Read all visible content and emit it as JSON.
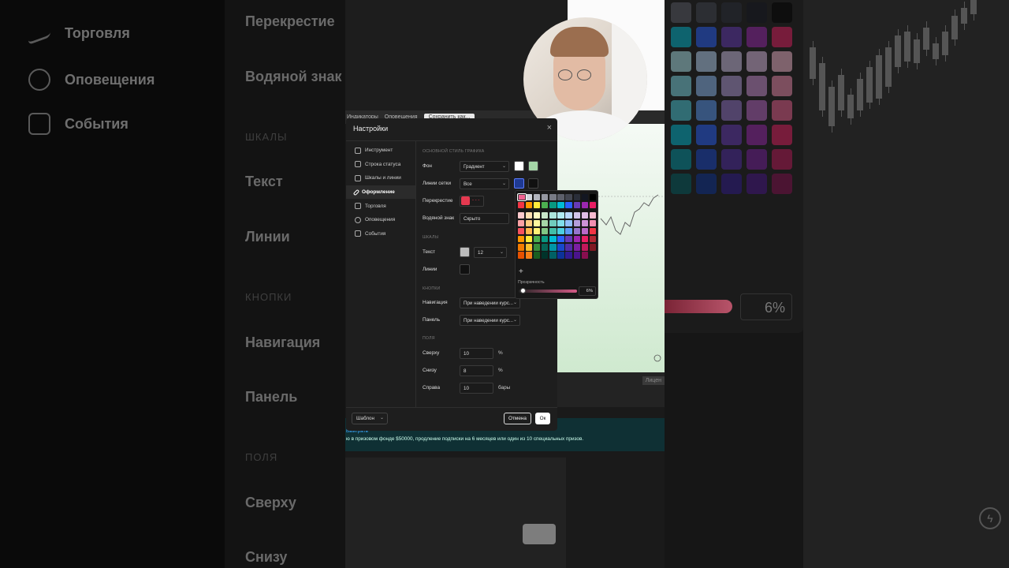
{
  "background_left": {
    "nav_items": [
      {
        "label": "Торговля",
        "icon": "trading-icon"
      },
      {
        "label": "Оповещения",
        "icon": "alarm-icon"
      },
      {
        "label": "События",
        "icon": "calendar-icon"
      }
    ],
    "right_column": {
      "crosshair": "Перекрестие",
      "watermark": "Водяной знак",
      "section_scales": "ШКАЛЫ",
      "text": "Текст",
      "lines": "Линии",
      "section_buttons": "КНОПКИ",
      "navigation": "Навигация",
      "panel": "Панель",
      "section_fields": "ПОЛЯ",
      "top": "Сверху",
      "bottom": "Снизу"
    }
  },
  "background_right": {
    "opacity_value": "6%"
  },
  "toolbar": {
    "items": [
      "Индикаторы",
      "Оповещения",
      "Сохранить как..."
    ]
  },
  "banner": {
    "link": "Выиграть",
    "message": "ю в призовом фонде $50000, продление подписки на 6 месяцев или один из 10 специальных призов."
  },
  "dialog": {
    "title": "Настройки",
    "close_label": "×",
    "nav": [
      {
        "label": "Инструмент",
        "icon": "candles-icon",
        "active": false
      },
      {
        "label": "Строка статуса",
        "icon": "status-line-icon",
        "active": false
      },
      {
        "label": "Шкалы и линии",
        "icon": "scales-icon",
        "active": false
      },
      {
        "label": "Оформление",
        "icon": "pencil-icon",
        "active": true
      },
      {
        "label": "Торговля",
        "icon": "trading-icon",
        "active": false
      },
      {
        "label": "Оповещения",
        "icon": "alarm-icon",
        "active": false
      },
      {
        "label": "События",
        "icon": "calendar-icon",
        "active": false
      }
    ],
    "content": {
      "section_chart_style": "ОСНОВНОЙ СТИЛЬ ГРАФИКА",
      "background_label": "Фон",
      "background_value": "Градиент",
      "grid_lines_label": "Линии сетки",
      "grid_lines_value": "Все",
      "crosshair_label": "Перекрестие",
      "watermark_label": "Водяной знак",
      "watermark_value": "Скрыто",
      "section_scales": "ШКАЛЫ",
      "text_label": "Текст",
      "text_size": "12",
      "lines_label": "Линии",
      "section_buttons": "КНОПКИ",
      "navigation_label": "Навигация",
      "navigation_value": "При наведении курс...",
      "panel_label": "Панель",
      "panel_value": "При наведении курс...",
      "section_fields": "ПОЛЯ",
      "top_label": "Сверху",
      "top_value": "10",
      "top_unit": "%",
      "bottom_label": "Снизу",
      "bottom_value": "8",
      "bottom_unit": "%",
      "right_label": "Справа",
      "right_value": "10",
      "right_unit": "бары"
    },
    "footer": {
      "template_label": "Шаблон",
      "cancel_label": "Отмена",
      "ok_label": "Ок"
    }
  },
  "colors": {
    "background_swatch_1": "#ffffff",
    "background_swatch_2": "#a5d6a7",
    "grid_swatch_1": "#1f3a93",
    "grid_swatch_2": "#111111",
    "crosshair_swatch": "#e53950",
    "text_swatch": "#bdbdbd",
    "lines_swatch": "#111111"
  },
  "color_picker": {
    "opacity_label": "Прозрачность",
    "opacity_value": "6%",
    "add_label": "+",
    "palette": [
      [
        "#ffffff",
        "#d1d4dc",
        "#b2b5be",
        "#9598a1",
        "#787b86",
        "#5d606b",
        "#434651",
        "#2a2e39",
        "#131722",
        "#000000"
      ],
      [
        "#f23645",
        "#ff9800",
        "#ffeb3b",
        "#4caf50",
        "#089981",
        "#00bcd4",
        "#2962ff",
        "#673ab7",
        "#9c27b0",
        "#e91e63"
      ],
      [
        "#fccbcd",
        "#ffe0b2",
        "#fff9c4",
        "#c8e6c9",
        "#ace5dc",
        "#b2ebf2",
        "#bbd9fb",
        "#d1c4e9",
        "#e1bee7",
        "#f8bbd0"
      ],
      [
        "#faa1a4",
        "#ffcc80",
        "#fff59d",
        "#a5d6a7",
        "#70ccbd",
        "#80deea",
        "#90bff9",
        "#b39ddb",
        "#ce93d8",
        "#f48fb1"
      ],
      [
        "#f7525f",
        "#ffb74d",
        "#fff176",
        "#81c784",
        "#42bda8",
        "#4dd0e1",
        "#5b9cf6",
        "#9575cd",
        "#ba68c8",
        "#f06292"
      ],
      [
        "#f23645",
        "#ff9800",
        "#ffeb3b",
        "#4caf50",
        "#089981",
        "#00bcd4",
        "#2962ff",
        "#673ab7",
        "#9c27b0",
        "#e91e63"
      ],
      [
        "#b22833",
        "#f57c00",
        "#fbc02d",
        "#388e3c",
        "#056656",
        "#0097a7",
        "#1848cc",
        "#512da8",
        "#7b1fa2",
        "#c2185b"
      ],
      [
        "#801922",
        "#e65100",
        "#f57f17",
        "#1b5e20",
        "#00332a",
        "#006064",
        "#0c3299",
        "#311b92",
        "#4a148c",
        "#880e4f"
      ]
    ],
    "selected": [
      4,
      9
    ]
  }
}
